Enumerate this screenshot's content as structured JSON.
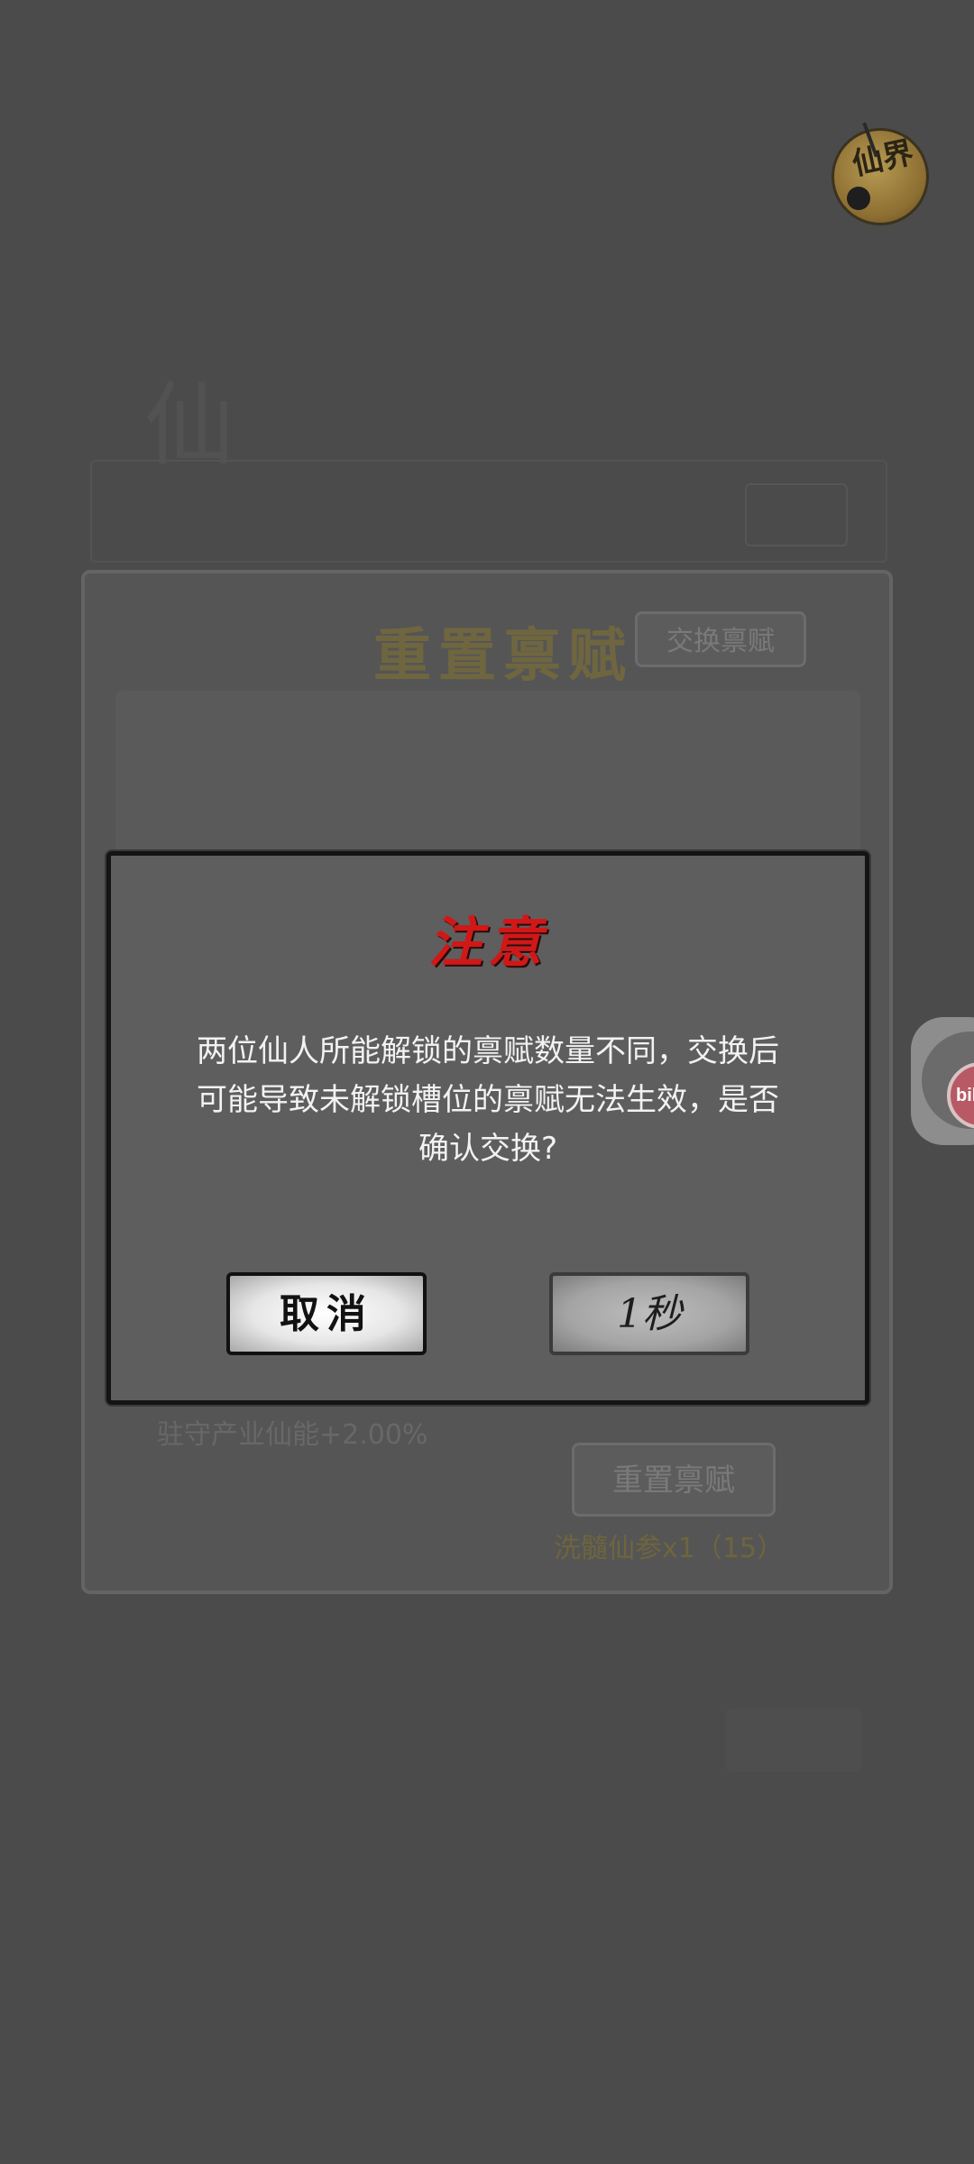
{
  "background": {
    "realm_badge_text": "仙界",
    "side_widget_label": "bili"
  },
  "talent_panel": {
    "title": "重置禀赋",
    "swap_tab_label": "交换禀赋",
    "bonus_text": "驻守产业仙能+2.00%",
    "reset_button_label": "重置禀赋",
    "cost_text": "洗髓仙参x1（15）"
  },
  "dialog": {
    "title": "注意",
    "message_line1": "两位仙人所能解锁的禀赋数量不同，交换后",
    "message_line2": "可能导致未解锁槽位的禀赋无法生效，是否",
    "message_line3": "确认交换?",
    "cancel_label": "取消",
    "confirm_label": "1秒"
  },
  "colors": {
    "overlay": "#4b4b4b",
    "dialog_bg": "#5e5e5e",
    "dialog_title": "#d01818",
    "gold_text": "#6e653e"
  }
}
